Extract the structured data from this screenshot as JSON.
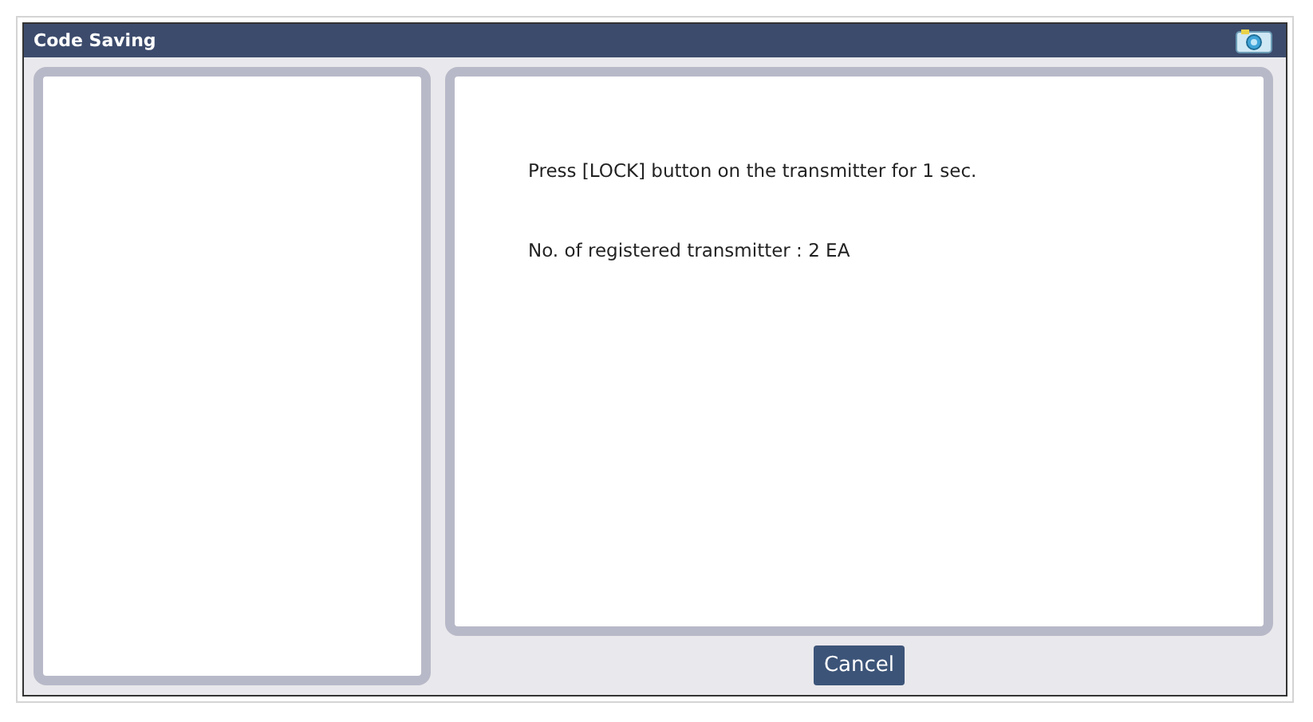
{
  "window": {
    "title": "Code Saving"
  },
  "messages": [
    "Press [LOCK] button on the transmitter for 1 sec.",
    "No. of registered transmitter : 2 EA"
  ],
  "buttons": [
    "Cancel"
  ]
}
